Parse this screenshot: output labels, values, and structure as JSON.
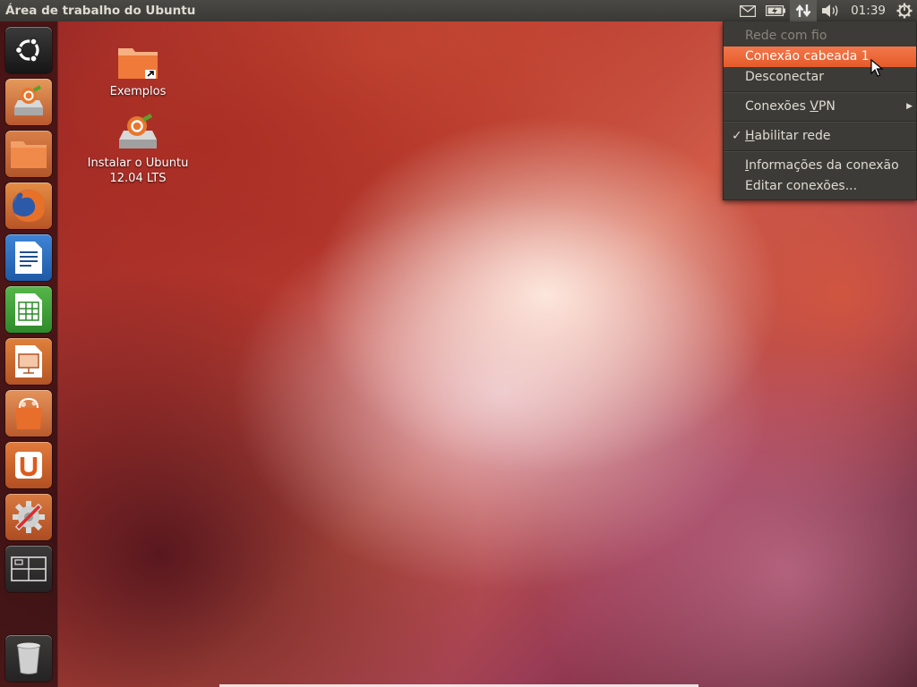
{
  "top_panel": {
    "title": "Área de trabalho do Ubuntu",
    "clock": "01:39",
    "indicators": [
      "mail-icon",
      "battery-icon",
      "network-icon",
      "sound-icon",
      "power-gear-icon"
    ]
  },
  "launcher": {
    "items": [
      {
        "name": "dash-home",
        "icon": "ubuntu-logo-icon"
      },
      {
        "name": "install-ubuntu",
        "icon": "installer-drive-icon"
      },
      {
        "name": "files",
        "icon": "folder-icon"
      },
      {
        "name": "firefox",
        "icon": "firefox-icon"
      },
      {
        "name": "libreoffice-writer",
        "icon": "writer-icon"
      },
      {
        "name": "libreoffice-calc",
        "icon": "calc-icon"
      },
      {
        "name": "libreoffice-impress",
        "icon": "impress-icon"
      },
      {
        "name": "software-center",
        "icon": "shopping-bag-icon"
      },
      {
        "name": "ubuntu-one",
        "icon": "ubuntu-one-icon"
      },
      {
        "name": "system-settings",
        "icon": "settings-icon"
      },
      {
        "name": "workspace-switcher",
        "icon": "workspaces-icon"
      },
      {
        "name": "trash",
        "icon": "trash-icon"
      }
    ]
  },
  "desktop": {
    "icons": [
      {
        "label": "Exemplos"
      },
      {
        "label_line1": "Instalar o Ubuntu",
        "label_line2": "12.04 LTS"
      }
    ]
  },
  "network_menu": {
    "header": "Rede com fio",
    "connection": "Conexão cabeada 1",
    "disconnect": "Desconectar",
    "vpn_prefix": "Conexões ",
    "vpn_underlined": "V",
    "vpn_suffix": "PN",
    "enable_underlined": "H",
    "enable_rest": "abilitar rede",
    "enable_checked": true,
    "info_underlined": "I",
    "info_rest": "nformações da conexão",
    "edit": "Editar conexões...",
    "accent_color": "#e95420"
  }
}
